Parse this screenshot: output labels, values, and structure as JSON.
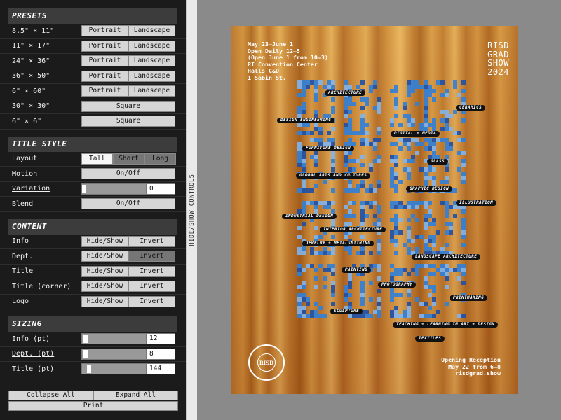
{
  "panel": {
    "presets": {
      "header": "PRESETS",
      "rows": [
        {
          "label": "8.5\" × 11\"",
          "buttons": [
            "Portrait",
            "Landscape"
          ]
        },
        {
          "label": "11\" × 17\"",
          "buttons": [
            "Portrait",
            "Landscape"
          ]
        },
        {
          "label": "24\" × 36\"",
          "buttons": [
            "Portrait",
            "Landscape"
          ]
        },
        {
          "label": "36\" × 50\"",
          "buttons": [
            "Portrait",
            "Landscape"
          ]
        },
        {
          "label": "6\" × 60\"",
          "buttons": [
            "Portrait",
            "Landscape"
          ]
        },
        {
          "label": "30\" × 30\"",
          "buttons": [
            "Square"
          ]
        },
        {
          "label": "6\" × 6\"",
          "buttons": [
            "Square"
          ]
        }
      ]
    },
    "title_style": {
      "header": "TITLE STYLE",
      "layout_label": "Layout",
      "layout_options": [
        "Tall",
        "Short",
        "Long"
      ],
      "layout_selected": "Tall",
      "motion_label": "Motion",
      "motion_button": "On/Off",
      "variation_label": "Variation",
      "variation_value": "0",
      "variation_level": 0,
      "blend_label": "Blend",
      "blend_button": "On/Off"
    },
    "content": {
      "header": "CONTENT",
      "rows": [
        {
          "label": "Info",
          "buttons": [
            "Hide/Show",
            "Invert"
          ],
          "invert_active": false
        },
        {
          "label": "Dept.",
          "buttons": [
            "Hide/Show",
            "Invert"
          ],
          "invert_active": true
        },
        {
          "label": "Title",
          "buttons": [
            "Hide/Show",
            "Invert"
          ],
          "invert_active": false
        },
        {
          "label": "Title (corner)",
          "buttons": [
            "Hide/Show",
            "Invert"
          ],
          "invert_active": false
        },
        {
          "label": "Logo",
          "buttons": [
            "Hide/Show",
            "Invert"
          ],
          "invert_active": false
        }
      ]
    },
    "sizing": {
      "header": "SIZING",
      "rows": [
        {
          "label": "Info (pt)",
          "value": "12",
          "level": 0.02
        },
        {
          "label": "Dept. (pt)",
          "value": "8",
          "level": 0.02
        },
        {
          "label": "Title (pt)",
          "value": "144",
          "level": 0.08
        }
      ]
    },
    "footer": {
      "collapse": "Collapse All",
      "expand": "Expand All",
      "print": "Print"
    }
  },
  "strip": {
    "label": "HIDE/SHOW CONTROLS"
  },
  "poster": {
    "info": "May 23–June 1\nOpen Daily 12–5\n(Open June 1 from 10–3)\nRI Convention Center\nHalls C&D\n1 Sabin St.",
    "corner_title": "RISD\nGRAD\nSHOW\n2024",
    "seal_mark": "RISD",
    "seal_ring_text": "ISLAND SCHOOL OF DESIGN · 1877",
    "reception": "Opening Reception\nMay 22 from 6–8\nrisdgrad.show",
    "departments": [
      "ARCHITECTURE",
      "CERAMICS",
      "DESIGN ENGINEERING",
      "DIGITAL + MEDIA",
      "FURNITURE DESIGN",
      "GLASS",
      "GLOBAL ARTS AND CULTURES",
      "GRAPHIC DESIGN",
      "ILLUSTRATION",
      "INDUSTRIAL DESIGN",
      "INTERIOR ARCHITECTURE",
      "JEWELRY + METALSMITHING",
      "LANDSCAPE ARCHITECTURE",
      "PAINTING",
      "PHOTOGRAPHY",
      "PRINTMAKING",
      "SCULPTURE",
      "TEACHING + LEARNING IN ART + DESIGN",
      "TEXTILES"
    ],
    "colors": {
      "glyph_blue": "#2f7fd9",
      "glyph_light": "#7fb4ee",
      "glyph_dark": "#1d4fa8"
    }
  }
}
